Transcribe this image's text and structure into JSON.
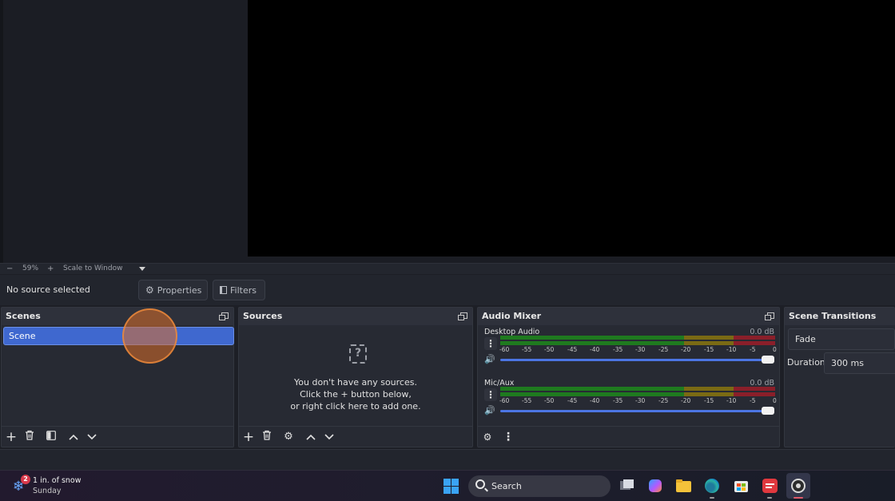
{
  "preview": {},
  "zoom": {
    "minus": "−",
    "level": "59%",
    "plus": "+",
    "mode": "Scale to Window"
  },
  "context": {
    "no_source": "No source selected",
    "properties_label": "Properties",
    "filters_label": "Filters"
  },
  "scenes": {
    "title": "Scenes",
    "items": [
      "Scene"
    ],
    "selected_index": 0
  },
  "sources": {
    "title": "Sources",
    "empty_line1": "You don't have any sources.",
    "empty_line2": "Click the + button below,",
    "empty_line3": "or right click here to add one."
  },
  "audio_mixer": {
    "title": "Audio Mixer",
    "channels": [
      {
        "name": "Desktop Audio",
        "db": "0.0 dB",
        "volume": 1.0
      },
      {
        "name": "Mic/Aux",
        "db": "0.0 dB",
        "volume": 1.0
      }
    ],
    "scale_ticks": [
      "-60",
      "-55",
      "-50",
      "-45",
      "-40",
      "-35",
      "-30",
      "-25",
      "-20",
      "-15",
      "-10",
      "-5",
      "0"
    ]
  },
  "transitions": {
    "title": "Scene Transitions",
    "selected": "Fade",
    "duration_label": "Duration",
    "duration_value": "300 ms"
  },
  "taskbar": {
    "weather_badge": "2",
    "weather_line1": "1 in. of snow",
    "weather_line2": "Sunday",
    "search_label": "Search"
  },
  "colors": {
    "accent": "#3f68cf",
    "meter_green": "#1f7a1f",
    "meter_yellow": "#7a6a14",
    "meter_red": "#8a1f2a"
  }
}
